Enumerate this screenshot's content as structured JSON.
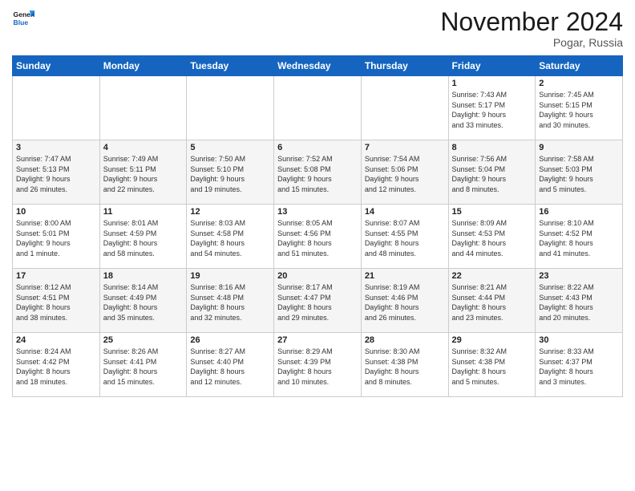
{
  "header": {
    "logo_line1": "General",
    "logo_line2": "Blue",
    "month_title": "November 2024",
    "location": "Pogar, Russia"
  },
  "weekdays": [
    "Sunday",
    "Monday",
    "Tuesday",
    "Wednesday",
    "Thursday",
    "Friday",
    "Saturday"
  ],
  "weeks": [
    [
      {
        "day": "",
        "info": ""
      },
      {
        "day": "",
        "info": ""
      },
      {
        "day": "",
        "info": ""
      },
      {
        "day": "",
        "info": ""
      },
      {
        "day": "",
        "info": ""
      },
      {
        "day": "1",
        "info": "Sunrise: 7:43 AM\nSunset: 5:17 PM\nDaylight: 9 hours\nand 33 minutes."
      },
      {
        "day": "2",
        "info": "Sunrise: 7:45 AM\nSunset: 5:15 PM\nDaylight: 9 hours\nand 30 minutes."
      }
    ],
    [
      {
        "day": "3",
        "info": "Sunrise: 7:47 AM\nSunset: 5:13 PM\nDaylight: 9 hours\nand 26 minutes."
      },
      {
        "day": "4",
        "info": "Sunrise: 7:49 AM\nSunset: 5:11 PM\nDaylight: 9 hours\nand 22 minutes."
      },
      {
        "day": "5",
        "info": "Sunrise: 7:50 AM\nSunset: 5:10 PM\nDaylight: 9 hours\nand 19 minutes."
      },
      {
        "day": "6",
        "info": "Sunrise: 7:52 AM\nSunset: 5:08 PM\nDaylight: 9 hours\nand 15 minutes."
      },
      {
        "day": "7",
        "info": "Sunrise: 7:54 AM\nSunset: 5:06 PM\nDaylight: 9 hours\nand 12 minutes."
      },
      {
        "day": "8",
        "info": "Sunrise: 7:56 AM\nSunset: 5:04 PM\nDaylight: 9 hours\nand 8 minutes."
      },
      {
        "day": "9",
        "info": "Sunrise: 7:58 AM\nSunset: 5:03 PM\nDaylight: 9 hours\nand 5 minutes."
      }
    ],
    [
      {
        "day": "10",
        "info": "Sunrise: 8:00 AM\nSunset: 5:01 PM\nDaylight: 9 hours\nand 1 minute."
      },
      {
        "day": "11",
        "info": "Sunrise: 8:01 AM\nSunset: 4:59 PM\nDaylight: 8 hours\nand 58 minutes."
      },
      {
        "day": "12",
        "info": "Sunrise: 8:03 AM\nSunset: 4:58 PM\nDaylight: 8 hours\nand 54 minutes."
      },
      {
        "day": "13",
        "info": "Sunrise: 8:05 AM\nSunset: 4:56 PM\nDaylight: 8 hours\nand 51 minutes."
      },
      {
        "day": "14",
        "info": "Sunrise: 8:07 AM\nSunset: 4:55 PM\nDaylight: 8 hours\nand 48 minutes."
      },
      {
        "day": "15",
        "info": "Sunrise: 8:09 AM\nSunset: 4:53 PM\nDaylight: 8 hours\nand 44 minutes."
      },
      {
        "day": "16",
        "info": "Sunrise: 8:10 AM\nSunset: 4:52 PM\nDaylight: 8 hours\nand 41 minutes."
      }
    ],
    [
      {
        "day": "17",
        "info": "Sunrise: 8:12 AM\nSunset: 4:51 PM\nDaylight: 8 hours\nand 38 minutes."
      },
      {
        "day": "18",
        "info": "Sunrise: 8:14 AM\nSunset: 4:49 PM\nDaylight: 8 hours\nand 35 minutes."
      },
      {
        "day": "19",
        "info": "Sunrise: 8:16 AM\nSunset: 4:48 PM\nDaylight: 8 hours\nand 32 minutes."
      },
      {
        "day": "20",
        "info": "Sunrise: 8:17 AM\nSunset: 4:47 PM\nDaylight: 8 hours\nand 29 minutes."
      },
      {
        "day": "21",
        "info": "Sunrise: 8:19 AM\nSunset: 4:46 PM\nDaylight: 8 hours\nand 26 minutes."
      },
      {
        "day": "22",
        "info": "Sunrise: 8:21 AM\nSunset: 4:44 PM\nDaylight: 8 hours\nand 23 minutes."
      },
      {
        "day": "23",
        "info": "Sunrise: 8:22 AM\nSunset: 4:43 PM\nDaylight: 8 hours\nand 20 minutes."
      }
    ],
    [
      {
        "day": "24",
        "info": "Sunrise: 8:24 AM\nSunset: 4:42 PM\nDaylight: 8 hours\nand 18 minutes."
      },
      {
        "day": "25",
        "info": "Sunrise: 8:26 AM\nSunset: 4:41 PM\nDaylight: 8 hours\nand 15 minutes."
      },
      {
        "day": "26",
        "info": "Sunrise: 8:27 AM\nSunset: 4:40 PM\nDaylight: 8 hours\nand 12 minutes."
      },
      {
        "day": "27",
        "info": "Sunrise: 8:29 AM\nSunset: 4:39 PM\nDaylight: 8 hours\nand 10 minutes."
      },
      {
        "day": "28",
        "info": "Sunrise: 8:30 AM\nSunset: 4:38 PM\nDaylight: 8 hours\nand 8 minutes."
      },
      {
        "day": "29",
        "info": "Sunrise: 8:32 AM\nSunset: 4:38 PM\nDaylight: 8 hours\nand 5 minutes."
      },
      {
        "day": "30",
        "info": "Sunrise: 8:33 AM\nSunset: 4:37 PM\nDaylight: 8 hours\nand 3 minutes."
      }
    ]
  ]
}
